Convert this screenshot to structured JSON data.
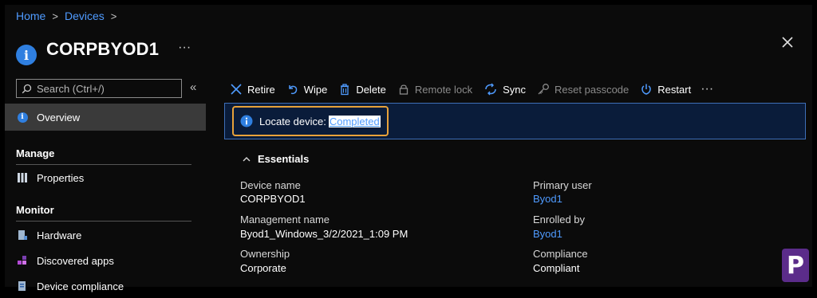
{
  "breadcrumb": {
    "home": "Home",
    "devices": "Devices",
    "sep": ">"
  },
  "header": {
    "title": "CORPBYOD1",
    "more": "···"
  },
  "sidebar": {
    "search_placeholder": "Search (Ctrl+/)",
    "collapse": "«",
    "overview": "Overview",
    "manage_heading": "Manage",
    "properties": "Properties",
    "monitor_heading": "Monitor",
    "hardware": "Hardware",
    "discovered_apps": "Discovered apps",
    "device_compliance": "Device compliance"
  },
  "toolbar": {
    "retire": "Retire",
    "wipe": "Wipe",
    "delete": "Delete",
    "remote_lock": "Remote lock",
    "sync": "Sync",
    "reset_passcode": "Reset passcode",
    "restart": "Restart",
    "more": "···"
  },
  "banner": {
    "text": "Locate device:",
    "status": "Completed"
  },
  "essentials": {
    "title": "Essentials",
    "device_name_label": "Device name",
    "device_name_value": "CORPBYOD1",
    "management_name_label": "Management name",
    "management_name_value": "Byod1_Windows_3/2/2021_1:09 PM",
    "ownership_label": "Ownership",
    "ownership_value": "Corporate",
    "primary_user_label": "Primary user",
    "primary_user_value": "Byod1",
    "enrolled_by_label": "Enrolled by",
    "enrolled_by_value": "Byod1",
    "compliance_label": "Compliance",
    "compliance_value": "Compliant"
  },
  "logo": {
    "letter": "P"
  },
  "colors": {
    "accent": "#4f9bff",
    "banner_bg": "#0a1c3a",
    "highlight": "#e8a23a",
    "selected": "#3a3a3a"
  }
}
